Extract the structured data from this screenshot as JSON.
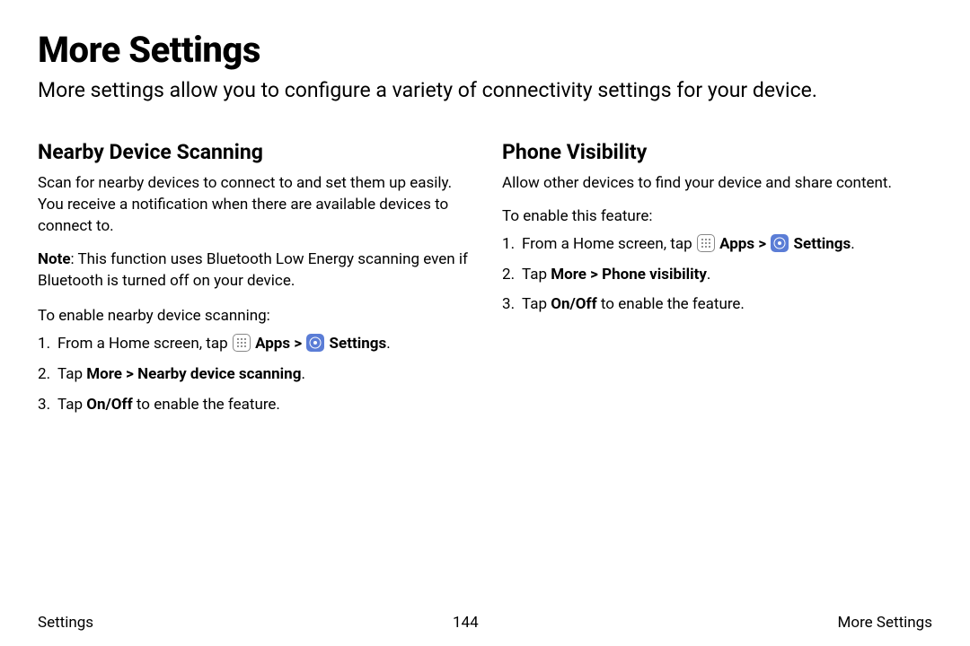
{
  "title": "More Settings",
  "intro": "More settings allow you to configure a variety of connectivity settings for your device.",
  "left": {
    "heading": "Nearby Device Scanning",
    "body": "Scan for nearby devices to connect to and set them up easily. You receive a notification when there are available devices to connect to.",
    "note_label": "Note",
    "note_text": ": This function uses Bluetooth Low Energy scanning even if Bluetooth is turned off on your device.",
    "lead": "To enable nearby device scanning:",
    "step1_pre": "From a Home screen, tap ",
    "step1_apps": "Apps",
    "step1_sep": " > ",
    "step1_settings": "Settings",
    "step1_end": ".",
    "step2_pre": "Tap ",
    "step2_bold": "More > Nearby device scanning",
    "step2_end": ".",
    "step3_pre": "Tap ",
    "step3_bold": "On/Off",
    "step3_end": " to enable the feature."
  },
  "right": {
    "heading": "Phone Visibility",
    "body": "Allow other devices to find your device and share content.",
    "lead": "To enable this feature:",
    "step1_pre": "From a Home screen, tap ",
    "step1_apps": "Apps",
    "step1_sep": " > ",
    "step1_settings": "Settings",
    "step1_end": ".",
    "step2_pre": "Tap ",
    "step2_bold": "More > Phone visibility",
    "step2_end": ".",
    "step3_pre": "Tap ",
    "step3_bold": "On/Off",
    "step3_end": " to enable the feature."
  },
  "footer": {
    "left": "Settings",
    "center": "144",
    "right": "More Settings"
  }
}
